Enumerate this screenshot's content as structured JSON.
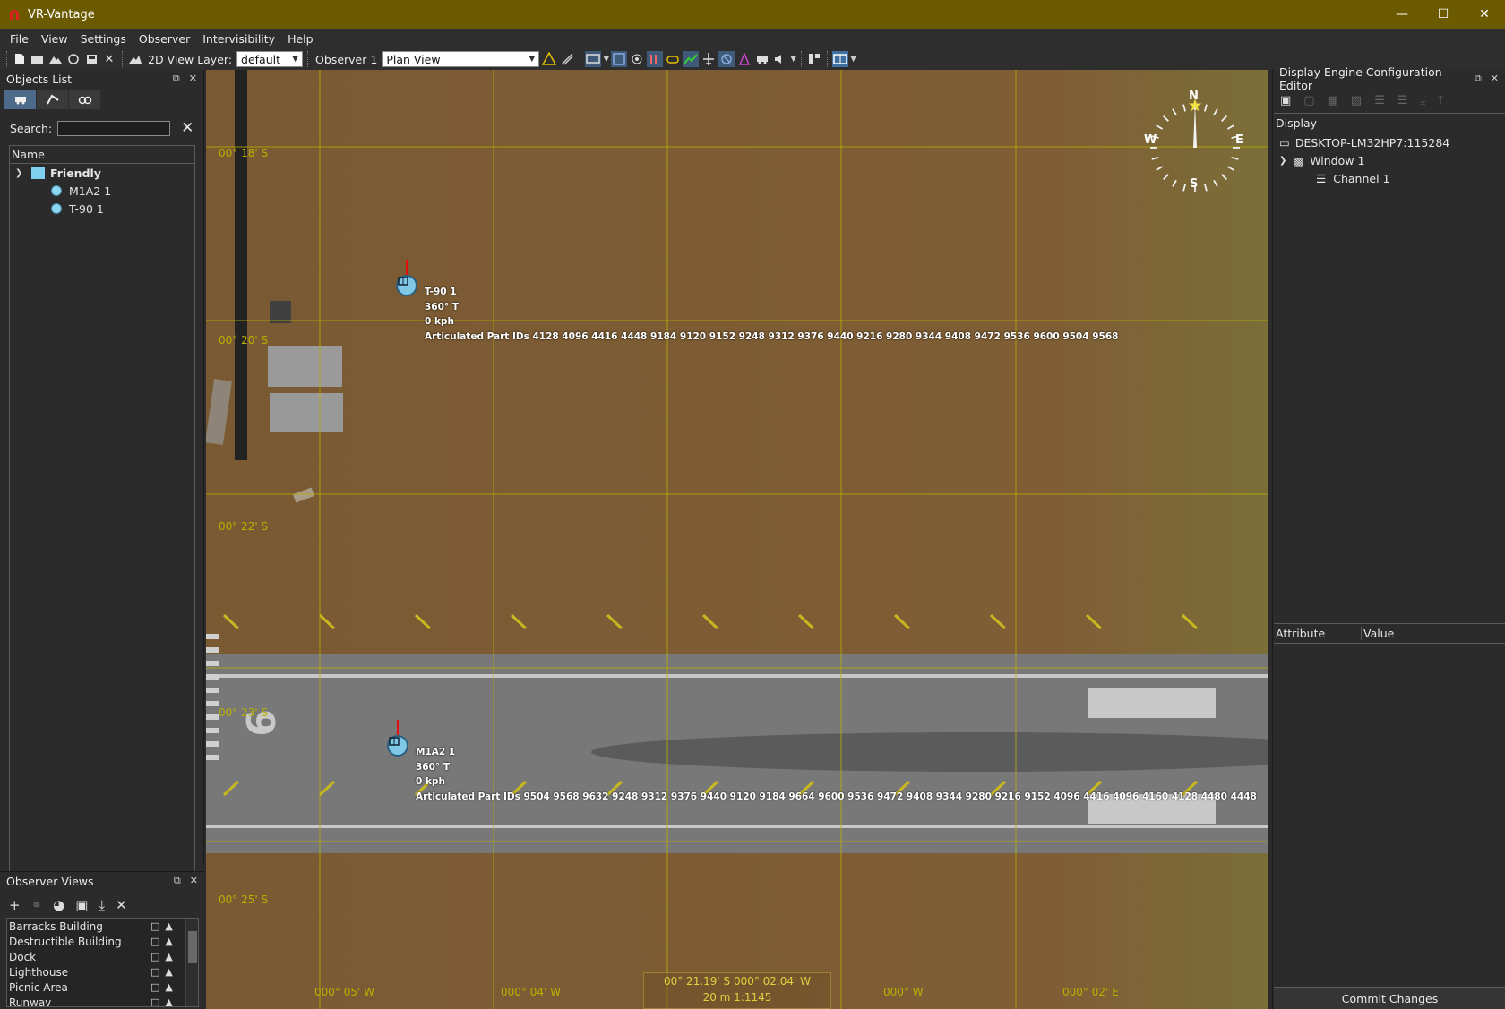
{
  "window": {
    "title": "VR-Vantage",
    "accent": "#6b5a00"
  },
  "menu": [
    "File",
    "View",
    "Settings",
    "Observer",
    "Intervisibility",
    "Help"
  ],
  "toolbar": {
    "view_layer_label": "2D View Layer:",
    "view_layer_value": "default",
    "observer_label": "Observer 1",
    "observer_view_value": "Plan View"
  },
  "objects_panel": {
    "title": "Objects List",
    "search_label": "Search:",
    "search_value": "",
    "column_name": "Name",
    "group": "Friendly",
    "group_color": "#7fd0ee",
    "items": [
      "M1A2 1",
      "T-90 1"
    ]
  },
  "observer_panel": {
    "title": "Observer Views",
    "views": [
      "Barracks Building",
      "Destructible Building",
      "Dock",
      "Lighthouse",
      "Picnic Area",
      "Runway"
    ]
  },
  "map": {
    "lat_labels": [
      "00° 18' S",
      "00° 20' S",
      "00° 22' S",
      "00° 23' S",
      "00° 25' S"
    ],
    "lon_labels": [
      "000° 05' W",
      "000° 04' W",
      "000° W",
      "000° 02' E"
    ],
    "compass": {
      "n": "N",
      "s": "S",
      "e": "E",
      "w": "W"
    },
    "units": [
      {
        "name": "T-90 1",
        "heading": "360° T",
        "speed": "0 kph",
        "parts": "Articulated Part IDs  4128 4096 4416 4448 9184 9120 9152 9248 9312 9376 9440 9216 9280 9344 9408 9472 9536 9600 9504 9568"
      },
      {
        "name": "M1A2 1",
        "heading": "360° T",
        "speed": "0 kph",
        "parts": "Articulated Part IDs  9504 9568 9632 9248 9312 9376 9440 9120 9184 9664 9600 9536 9472 9408 9344 9280 9216 9152 4096 4416 4096 4160 4128 4480 4448"
      }
    ],
    "status_coords": "00° 21.19' S  000° 02.04' W",
    "status_scale": "20 m   1:1145",
    "runway_number": "9"
  },
  "dec_panel": {
    "title": "Display Engine Configuration Editor",
    "column_display": "Display",
    "host": "DESKTOP-LM32HP7:115284",
    "window": "Window 1",
    "channel": "Channel 1",
    "attr_col": "Attribute",
    "value_col": "Value",
    "commit_label": "Commit Changes"
  }
}
